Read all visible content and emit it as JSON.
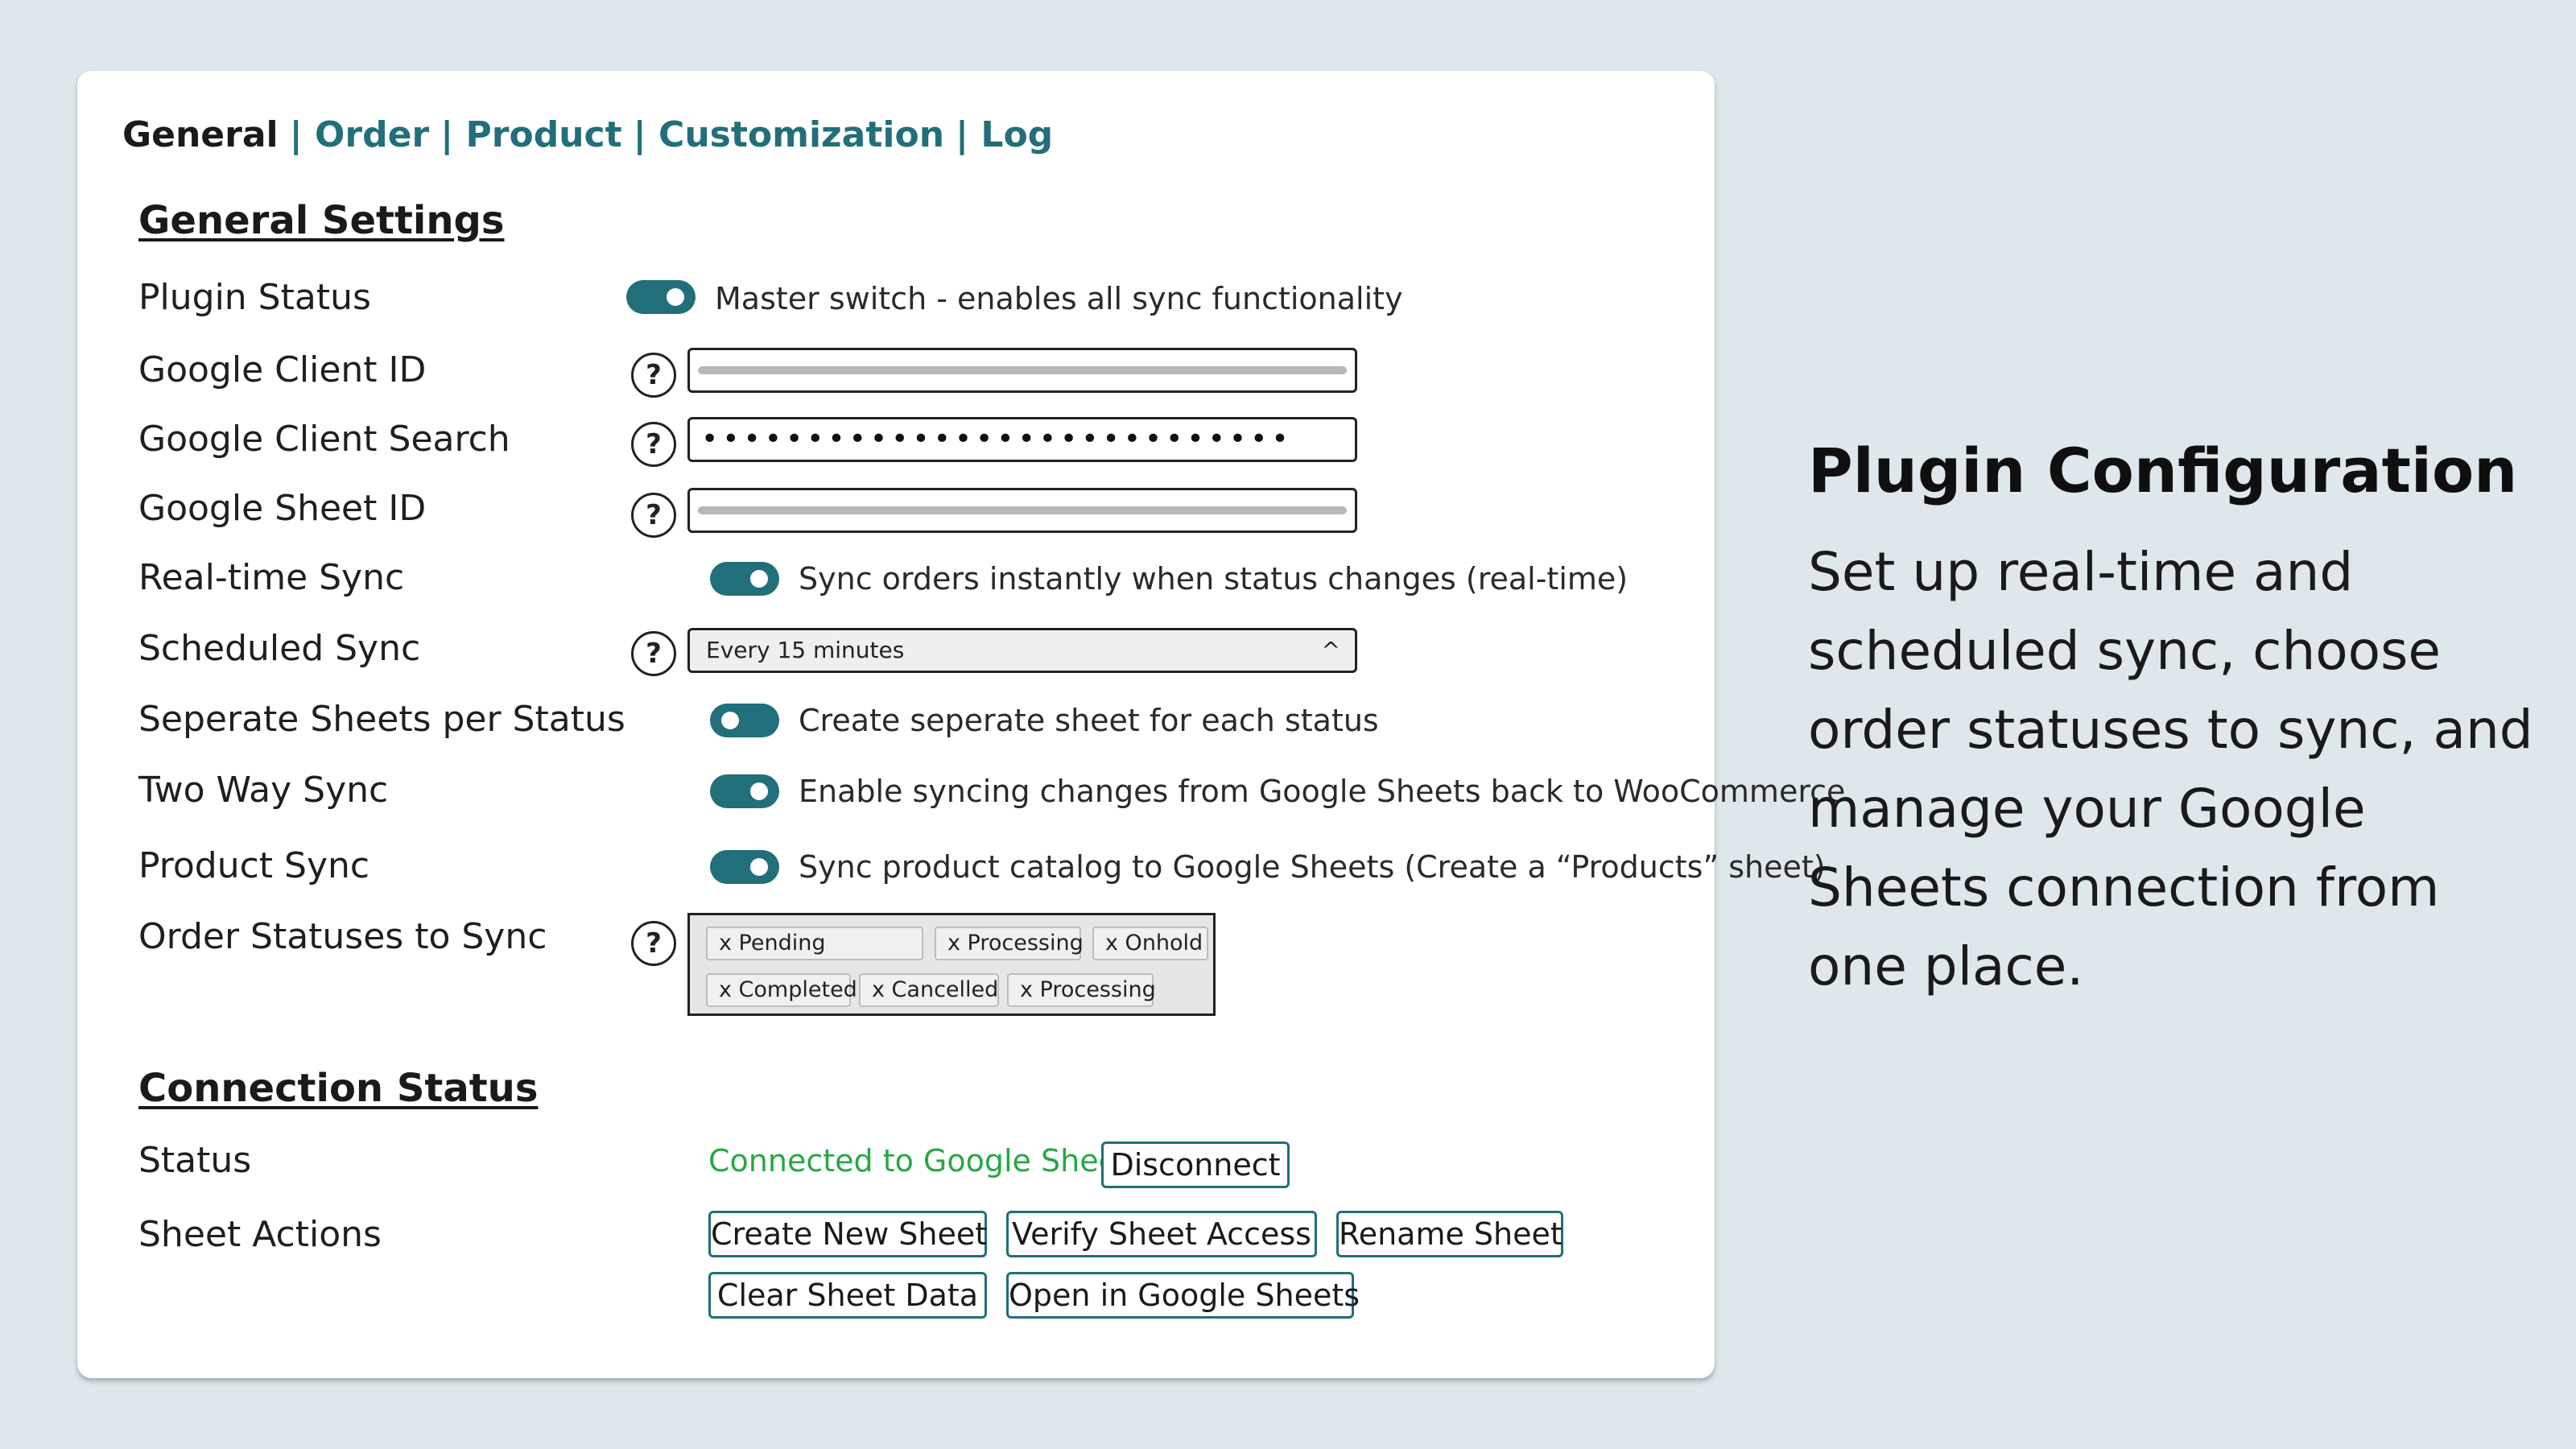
{
  "tabs": [
    {
      "label": "General",
      "active": true
    },
    {
      "label": "Order",
      "active": false
    },
    {
      "label": "Product",
      "active": false
    },
    {
      "label": "Customization",
      "active": false
    },
    {
      "label": "Log",
      "active": false
    }
  ],
  "tab_separator": "|",
  "general_settings": {
    "title": "General Settings",
    "plugin_status": {
      "label": "Plugin Status",
      "enabled": true,
      "description": "Master switch - enables all sync functionality"
    },
    "google_client_id": {
      "label": "Google Client ID",
      "help": "?"
    },
    "google_client_search": {
      "label": "Google Client Search",
      "help": "?",
      "masked_value": "••••••••••••••••••••••••••••"
    },
    "google_sheet_id": {
      "label": "Google Sheet ID",
      "help": "?"
    },
    "realtime_sync": {
      "label": "Real-time Sync",
      "enabled": true,
      "description": "Sync orders instantly when status changes (real-time)"
    },
    "scheduled_sync": {
      "label": "Scheduled Sync",
      "help": "?",
      "selected": "Every 15 minutes",
      "caret": "^"
    },
    "separate_sheets": {
      "label": "Seperate Sheets per Status",
      "enabled": false,
      "description": "Create seperate sheet for each status"
    },
    "two_way_sync": {
      "label": "Two Way Sync",
      "enabled": true,
      "description": "Enable syncing changes from Google Sheets back to WooCommerce"
    },
    "product_sync": {
      "label": "Product Sync",
      "enabled": true,
      "description": "Sync product catalog to Google Sheets (Create a “Products” sheet)"
    },
    "order_statuses": {
      "label": "Order Statuses to Sync",
      "help": "?",
      "tags": [
        "x Pending",
        "x Processing",
        "x Onhold",
        "x Completed",
        "x Cancelled",
        "x Processing"
      ]
    }
  },
  "connection_status": {
    "title": "Connection Status",
    "status_label": "Status",
    "status_text": "Connected to Google Sheets",
    "disconnect": "Disconnect",
    "actions_label": "Sheet Actions",
    "actions": [
      "Create New Sheet",
      "Verify Sheet Access",
      "Rename Sheet",
      "Clear Sheet Data",
      "Open in Google Sheets"
    ]
  },
  "side": {
    "title": "Plugin Configuration",
    "body": "Set up real-time and scheduled sync, choose order statuses to sync, and manage your Google Sheets connection from one place."
  },
  "colors": {
    "accent": "#216f7a",
    "success": "#28a745",
    "background": "#dde7ec"
  }
}
